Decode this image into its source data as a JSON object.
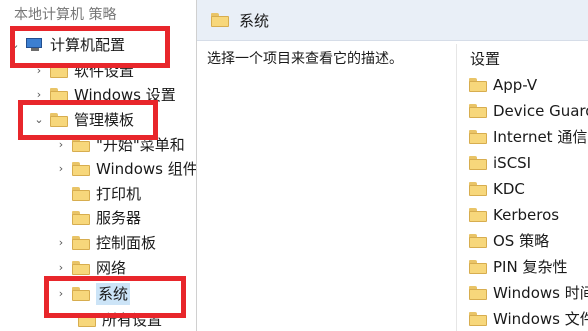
{
  "tree": {
    "partial_top": "本地计算机 策略",
    "computer_config": "计算机配置",
    "software_settings": "软件设置",
    "windows_settings": "Windows 设置",
    "admin_templates": "管理模板",
    "start_menu_taskbar": "\"开始\"菜单和",
    "windows_components": "Windows 组件",
    "printers": "打印机",
    "servers": "服务器",
    "control_panel": "控制面板",
    "network": "网络",
    "system": "系统",
    "all_settings": "所有设置"
  },
  "right": {
    "header_title": "系统",
    "description": "选择一个项目来查看它的描述。",
    "settings_title": "设置",
    "items": [
      "App-V",
      "Device Guard",
      "Internet 通信管",
      "iSCSI",
      "KDC",
      "Kerberos",
      "OS 策略",
      "PIN 复杂性",
      "Windows 时间",
      "Windows 文件"
    ]
  },
  "colors": {
    "highlight_box": "#e8262b",
    "header_bg": "#e9eff7",
    "folder": "#f7d77b"
  }
}
